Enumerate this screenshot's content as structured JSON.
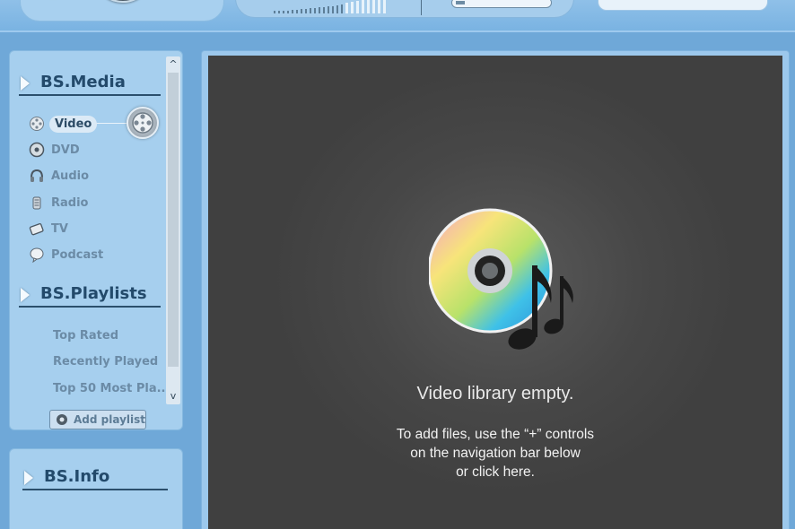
{
  "colors": {
    "background": "#6fa8d8",
    "panel": "#a6cfee",
    "heading": "#234a6b",
    "nav_text": "#6b8ba6",
    "library_bg": "#474747",
    "library_text": "#e9e9e9"
  },
  "toolbar": {
    "prev_icon": "previous-icon",
    "play_icon": "play-icon",
    "next_icon": "next-icon"
  },
  "sidebar": {
    "media_title": "BS.Media",
    "media_items": [
      {
        "label": "Video",
        "icon": "film-reel-icon",
        "active": true
      },
      {
        "label": "DVD",
        "icon": "dvd-icon",
        "active": false
      },
      {
        "label": "Audio",
        "icon": "headphones-icon",
        "active": false
      },
      {
        "label": "Radio",
        "icon": "radio-icon",
        "active": false
      },
      {
        "label": "TV",
        "icon": "tv-icon",
        "active": false
      },
      {
        "label": "Podcast",
        "icon": "podcast-bubble-icon",
        "active": false
      }
    ],
    "playlists_title": "BS.Playlists",
    "playlist_items": [
      "Top Rated",
      "Recently Played",
      "Top 50 Most Pla..."
    ],
    "add_playlist_label": "Add playlist",
    "scroll_up_symbol": "^",
    "scroll_down_symbol": "v",
    "info_title": "BS.Info"
  },
  "library": {
    "empty_title": "Video library empty.",
    "hint_line_1": "To add files, use the “+” controls",
    "hint_line_2": "on the navigation bar below",
    "hint_line_3": "or click here."
  }
}
